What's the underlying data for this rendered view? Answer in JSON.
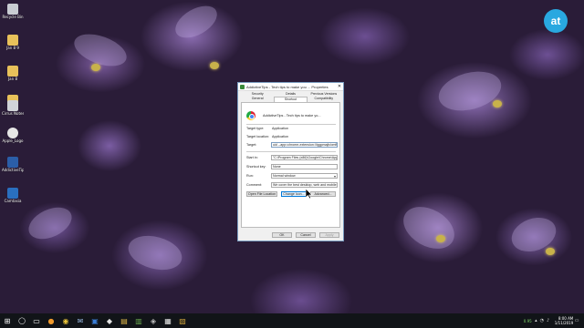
{
  "logo": {
    "text": "at"
  },
  "desktop_icons": [
    {
      "label": "Recycle Bin",
      "color": "#c9cdd3"
    },
    {
      "label": "Jan 8 9",
      "color": "#e8c15a"
    },
    {
      "label": "Jan 8",
      "color": "#e8c15a"
    },
    {
      "label": "Jan 8",
      "color": "#e8c15a"
    },
    {
      "label": "Cirrus Notes",
      "color": "#d0d3d8"
    },
    {
      "label": "Apple_Logo",
      "color": "#e6e6e6"
    },
    {
      "label": "AddictiveTips - Tech tips",
      "color": "#2b5ea8"
    },
    {
      "label": "Camtasia",
      "color": "#2a6fbf"
    }
  ],
  "dialog": {
    "title": "AddictiveTips - Tech tips to make you ... Properties",
    "close": "✕",
    "tabs_row1": [
      "Security",
      "Details",
      "Previous Versions"
    ],
    "tabs_row2": [
      "General",
      "Shortcut",
      "Compatibility"
    ],
    "app_name": "AddictiveTips - Tech tips to make yo...",
    "labels": {
      "target_type": "Target type:",
      "target_location": "Target location:",
      "target": "Target:",
      "start_in": "Start in:",
      "shortcut_key": "Shortcut key:",
      "run": "Run:",
      "comment": "Comment:"
    },
    "values": {
      "target_type": "Application",
      "target_location": "Application",
      "target": "uid --app=chrome-extension://iggpmajh/omfhgnfmcik",
      "start_in": "\"C:\\Program Files (x86)\\Google\\Chrome\\Applicati",
      "shortcut_key": "None",
      "run": "Normal window",
      "comment": "We cover the best desktop, web and mobile apps"
    },
    "buttons": {
      "open_location": "Open File Location",
      "change_icon": "Change Icon...",
      "advanced": "Advanced...",
      "ok": "OK",
      "cancel": "Cancel",
      "apply": "Apply"
    }
  },
  "taskbar": {
    "apps": [
      "⊞",
      "◯",
      "▭",
      "●",
      "◉",
      "✉",
      "▣",
      "◆",
      "▤",
      "▥",
      "◈",
      "▦",
      "▧"
    ],
    "meter": "0.95",
    "time": "8:00 AM",
    "date": "1/11/2019"
  }
}
